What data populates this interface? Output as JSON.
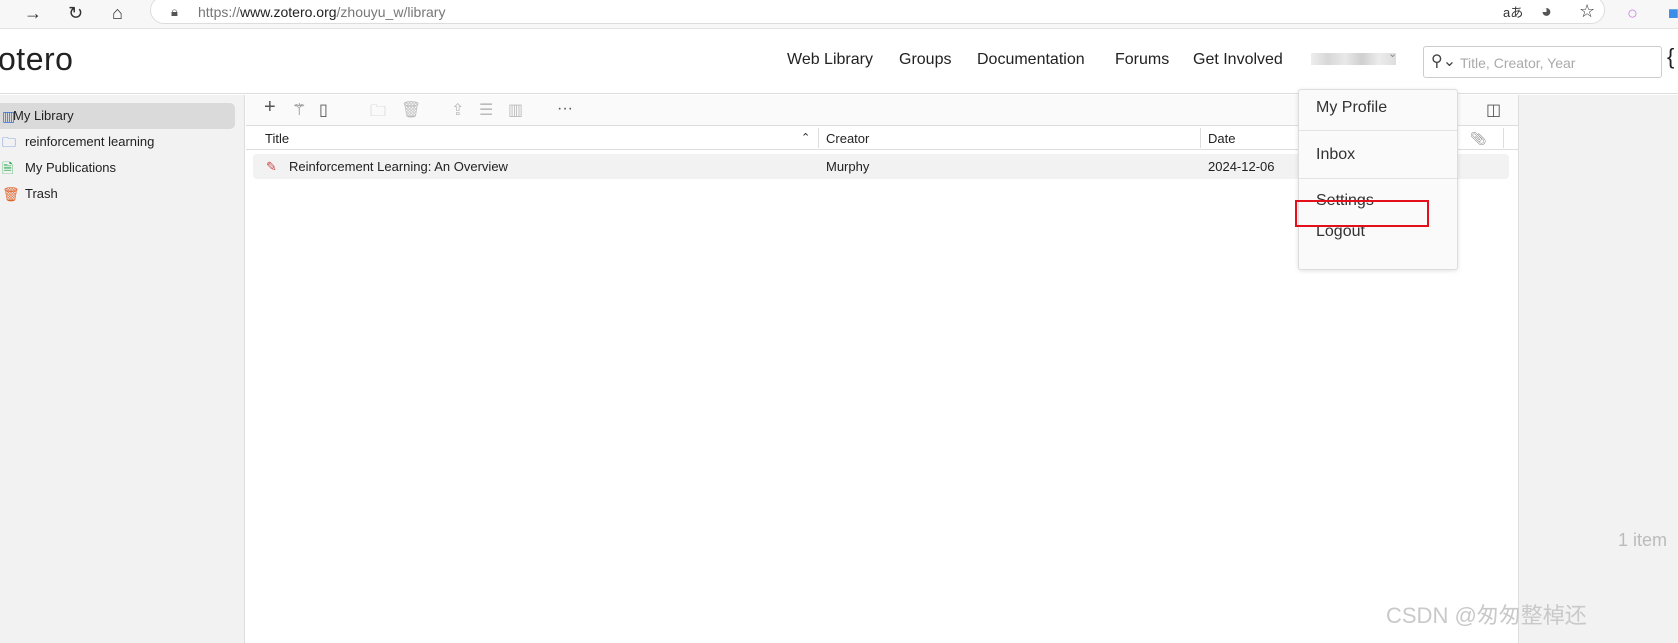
{
  "browser": {
    "url_scheme": "https://",
    "url_host": "www.zotero.org",
    "url_path": "/zhouyu_w/library",
    "icons": [
      "forward-icon",
      "refresh-icon",
      "home-icon",
      "lock-icon",
      "read-aloud-icon",
      "edge-icon",
      "favorite-star-icon",
      "extension-icon"
    ],
    "read_aloud": "aあ"
  },
  "header": {
    "logo": "otero",
    "nav": [
      "Web Library",
      "Groups",
      "Documentation",
      "Forums",
      "Get Involved"
    ],
    "search_placeholder": "Title, Creator, Year"
  },
  "sidebar": {
    "items": [
      {
        "label": "My Library",
        "icon": "library-icon",
        "color": "#3a6fd8"
      },
      {
        "label": "reinforcement learning",
        "icon": "folder-icon",
        "color": "#3a6fd8"
      },
      {
        "label": "My Publications",
        "icon": "publications-icon",
        "color": "#2ea84f"
      },
      {
        "label": "Trash",
        "icon": "trash-icon",
        "color": "#e0622a"
      }
    ]
  },
  "table": {
    "columns": [
      "Title",
      "Creator",
      "Date"
    ],
    "rows": [
      {
        "title": "Reinforcement Learning: An Overview",
        "creator": "Murphy",
        "date": "2024-12-06"
      }
    ]
  },
  "status": {
    "count": "1 item"
  },
  "user_menu": {
    "items": [
      "My Profile",
      "Inbox",
      "Settings",
      "Logout"
    ],
    "highlighted": "Settings",
    "highlight_color": "#e3101b"
  },
  "watermark": "CSDN @匆匆整棹还"
}
